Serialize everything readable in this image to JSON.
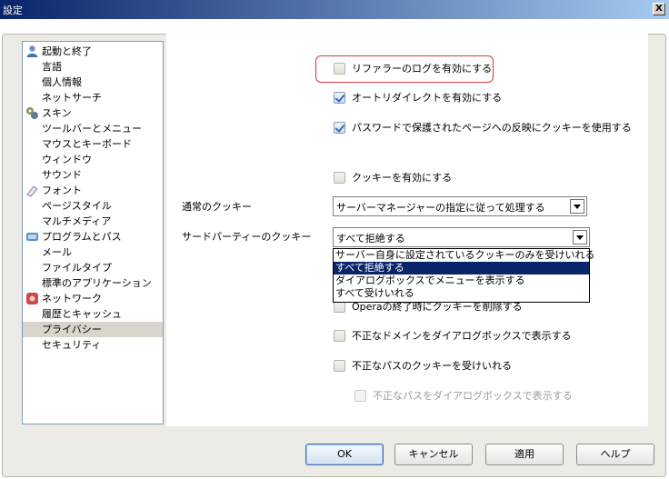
{
  "window": {
    "title": "設定",
    "close_label": "X"
  },
  "tree": [
    {
      "label": "起動と終了",
      "icon": "person-icon",
      "level": 0
    },
    {
      "label": "言語",
      "level": 1
    },
    {
      "label": "個人情報",
      "level": 1
    },
    {
      "label": "ネットサーチ",
      "level": 1
    },
    {
      "label": "スキン",
      "icon": "skin-icon",
      "level": 0
    },
    {
      "label": "ツールバーとメニュー",
      "level": 1
    },
    {
      "label": "マウスとキーボード",
      "level": 1
    },
    {
      "label": "ウィンドウ",
      "level": 1
    },
    {
      "label": "サウンド",
      "level": 1
    },
    {
      "label": "フォント",
      "icon": "font-icon",
      "level": 0
    },
    {
      "label": "ページスタイル",
      "level": 1
    },
    {
      "label": "マルチメディア",
      "level": 1
    },
    {
      "label": "プログラムとパス",
      "icon": "programs-icon",
      "level": 0
    },
    {
      "label": "メール",
      "level": 1
    },
    {
      "label": "ファイルタイプ",
      "level": 1
    },
    {
      "label": "標準のアプリケーション",
      "level": 1
    },
    {
      "label": "ネットワーク",
      "icon": "network-icon",
      "level": 0
    },
    {
      "label": "履歴とキャッシュ",
      "level": 1
    },
    {
      "label": "プライバシー",
      "level": 1,
      "selected": true
    },
    {
      "label": "セキュリティ",
      "level": 1
    }
  ],
  "settings": {
    "referrer_log": {
      "label": "リファラーのログを有効にする",
      "checked": false
    },
    "auto_redirect": {
      "label": "オートリダイレクトを有効にする",
      "checked": true
    },
    "password_cookie": {
      "label": "パスワードで保護されたページへの反映にクッキーを使用する",
      "checked": true
    },
    "enable_cookies": {
      "label": "クッキーを有効にする",
      "checked": false
    },
    "normal_cookies": {
      "label": "通常のクッキー",
      "value": "サーバーマネージャーの指定に従って処理する"
    },
    "third_party_cookies": {
      "label": "サードパーティーのクッキー",
      "value": "すべて拒絶する"
    },
    "third_party_options": [
      {
        "label": "サーバー自身に設定されているクッキーのみを受けいれる",
        "selected": false
      },
      {
        "label": "すべて拒絶する",
        "selected": true
      },
      {
        "label": "ダイアログボックスでメニューを表示する",
        "selected": false
      },
      {
        "label": "すべて受けいれる",
        "selected": false
      }
    ],
    "delete_on_exit": {
      "label": "Operaの終了時にクッキーを削除する",
      "checked": false
    },
    "invalid_domain_dialog": {
      "label": "不正なドメインをダイアログボックスで表示する",
      "checked": false
    },
    "accept_invalid_path": {
      "label": "不正なパスのクッキーを受けいれる",
      "checked": false
    },
    "invalid_path_dialog": {
      "label": "不正なパスをダイアログボックスで表示する",
      "checked": false,
      "disabled": true
    }
  },
  "buttons": {
    "ok": "OK",
    "cancel": "キャンセル",
    "apply": "適用",
    "help": "ヘルプ"
  }
}
